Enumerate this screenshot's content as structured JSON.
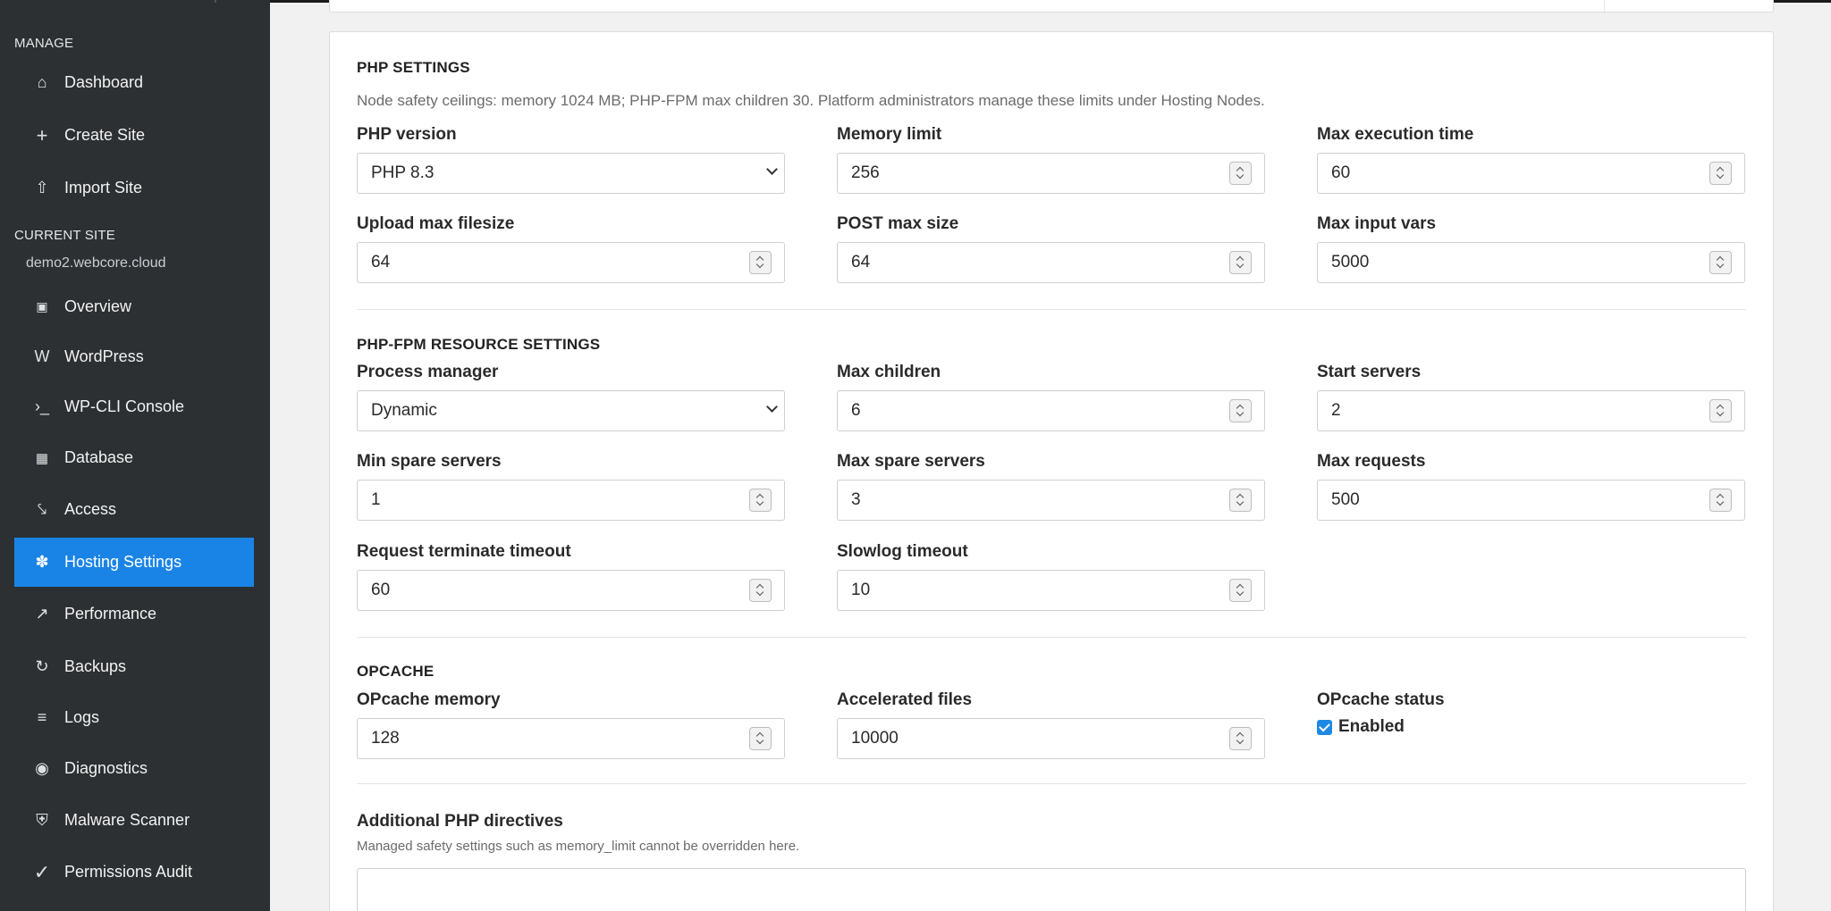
{
  "sidebar": {
    "manage_label": "MANAGE",
    "current_site_label": "CURRENT SITE",
    "site_name": "demo2.webcore.cloud",
    "manage_items": [
      {
        "label": "Dashboard",
        "icon": "home-icon",
        "glyph": "⌂"
      },
      {
        "label": "Create Site",
        "icon": "plus-icon",
        "glyph": "+"
      },
      {
        "label": "Import Site",
        "icon": "upload-arrow-icon",
        "glyph": "⇧"
      }
    ],
    "site_items": [
      {
        "label": "Overview",
        "icon": "overview-square-icon",
        "glyph": "▣"
      },
      {
        "label": "WordPress",
        "icon": "wordpress-icon",
        "glyph": "W"
      },
      {
        "label": "WP-CLI Console",
        "icon": "terminal-icon",
        "glyph": "›_"
      },
      {
        "label": "Database",
        "icon": "database-grid-icon",
        "glyph": "▦"
      },
      {
        "label": "Access",
        "icon": "access-key-icon",
        "glyph": "⤥"
      },
      {
        "label": "Hosting Settings",
        "icon": "gear-icon",
        "glyph": "✽",
        "active": true
      },
      {
        "label": "Performance",
        "icon": "trend-arrow-icon",
        "glyph": "↗"
      },
      {
        "label": "Backups",
        "icon": "refresh-icon",
        "glyph": "↻"
      },
      {
        "label": "Logs",
        "icon": "list-lines-icon",
        "glyph": "≡"
      },
      {
        "label": "Diagnostics",
        "icon": "target-icon",
        "glyph": "◉"
      },
      {
        "label": "Malware Scanner",
        "icon": "shield-icon",
        "glyph": "⛨"
      },
      {
        "label": "Permissions Audit",
        "icon": "checkmark-icon",
        "glyph": "✓"
      }
    ]
  },
  "php": {
    "title": "PHP SETTINGS",
    "note": "Node safety ceilings: memory 1024 MB; PHP-FPM max children 30. Platform administrators manage these limits under Hosting Nodes.",
    "php_version": {
      "label": "PHP version",
      "value": "PHP 8.3"
    },
    "memory_limit": {
      "label": "Memory limit",
      "value": "256"
    },
    "max_execution_time": {
      "label": "Max execution time",
      "value": "60"
    },
    "upload_max_filesize": {
      "label": "Upload max filesize",
      "value": "64"
    },
    "post_max_size": {
      "label": "POST max size",
      "value": "64"
    },
    "max_input_vars": {
      "label": "Max input vars",
      "value": "5000"
    }
  },
  "fpm": {
    "title": "PHP-FPM RESOURCE SETTINGS",
    "process_manager": {
      "label": "Process manager",
      "value": "Dynamic"
    },
    "max_children": {
      "label": "Max children",
      "value": "6"
    },
    "start_servers": {
      "label": "Start servers",
      "value": "2"
    },
    "min_spare_servers": {
      "label": "Min spare servers",
      "value": "1"
    },
    "max_spare_servers": {
      "label": "Max spare servers",
      "value": "3"
    },
    "max_requests": {
      "label": "Max requests",
      "value": "500"
    },
    "request_terminate_timeout": {
      "label": "Request terminate timeout",
      "value": "60"
    },
    "slowlog_timeout": {
      "label": "Slowlog timeout",
      "value": "10"
    }
  },
  "opcache": {
    "title": "OPCACHE",
    "memory": {
      "label": "OPcache memory",
      "value": "128"
    },
    "accelerated_files": {
      "label": "Accelerated files",
      "value": "10000"
    },
    "status": {
      "label": "OPcache status",
      "checkbox_label": "Enabled",
      "checked": true
    }
  },
  "directives": {
    "label": "Additional PHP directives",
    "note": "Managed safety settings such as memory_limit cannot be overridden here.",
    "value": ""
  },
  "colors": {
    "sidebar_bg": "#2c3033",
    "active_item": "#1a84e6",
    "page_bg": "#f1f1f1",
    "checkbox": "#1e88e5"
  }
}
